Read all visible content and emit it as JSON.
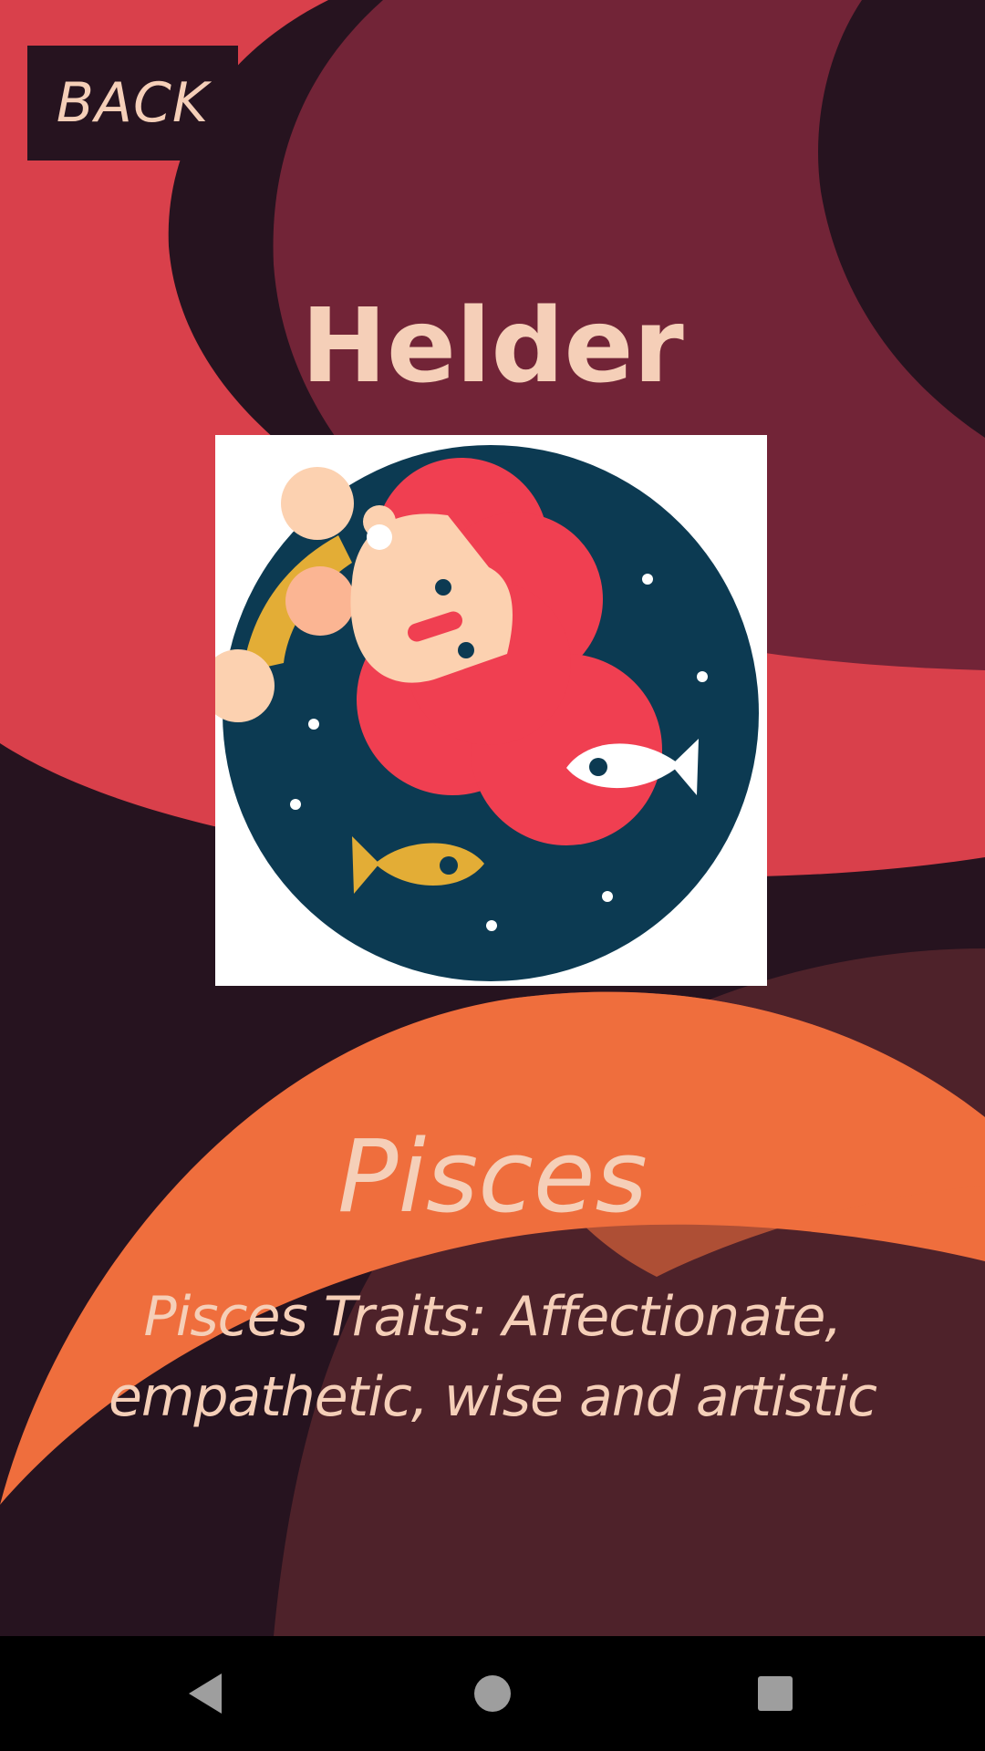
{
  "header": {
    "back_label": "BACK"
  },
  "profile": {
    "name": "Helder"
  },
  "sign": {
    "name": "Pisces",
    "traits": "Pisces Traits: Affectionate, empathetic, wise and artistic",
    "illustration": "pisces-mermaid-illustration"
  },
  "navigation": {
    "back_icon": "triangle-back-icon",
    "home_icon": "circle-home-icon",
    "recents_icon": "square-recents-icon"
  },
  "colors": {
    "background": "#26131f",
    "accent_red": "#d9404b",
    "accent_maroon": "#722437",
    "accent_orange": "#ef6e3d",
    "text": "#f5cfb8",
    "nav_bar": "#000000"
  }
}
